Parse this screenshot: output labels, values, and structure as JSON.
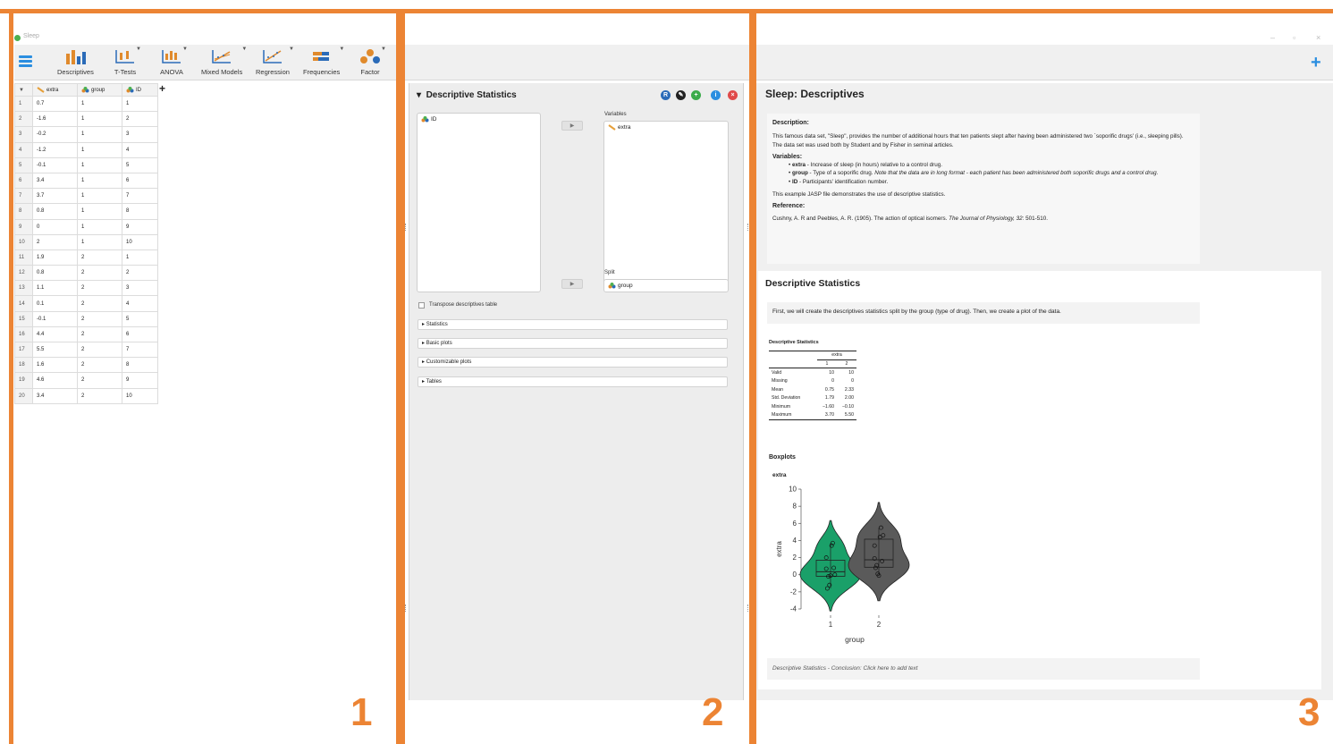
{
  "window": {
    "title": "Sleep"
  },
  "toolbar": {
    "items": [
      {
        "label": "Descriptives",
        "icon": "descriptives-icon"
      },
      {
        "label": "T-Tests",
        "icon": "t-tests-icon"
      },
      {
        "label": "ANOVA",
        "icon": "anova-icon"
      },
      {
        "label": "Mixed Models",
        "icon": "mixed-models-icon"
      },
      {
        "label": "Regression",
        "icon": "regression-icon"
      },
      {
        "label": "Frequencies",
        "icon": "frequencies-icon"
      },
      {
        "label": "Factor",
        "icon": "factor-icon"
      }
    ]
  },
  "grid": {
    "columns": [
      "extra",
      "group",
      "ID"
    ],
    "rows": [
      [
        "1",
        "0.7",
        "1",
        "1"
      ],
      [
        "2",
        "-1.6",
        "1",
        "2"
      ],
      [
        "3",
        "-0.2",
        "1",
        "3"
      ],
      [
        "4",
        "-1.2",
        "1",
        "4"
      ],
      [
        "5",
        "-0.1",
        "1",
        "5"
      ],
      [
        "6",
        "3.4",
        "1",
        "6"
      ],
      [
        "7",
        "3.7",
        "1",
        "7"
      ],
      [
        "8",
        "0.8",
        "1",
        "8"
      ],
      [
        "9",
        "0",
        "1",
        "9"
      ],
      [
        "10",
        "2",
        "1",
        "10"
      ],
      [
        "11",
        "1.9",
        "2",
        "1"
      ],
      [
        "12",
        "0.8",
        "2",
        "2"
      ],
      [
        "13",
        "1.1",
        "2",
        "3"
      ],
      [
        "14",
        "0.1",
        "2",
        "4"
      ],
      [
        "15",
        "-0.1",
        "2",
        "5"
      ],
      [
        "16",
        "4.4",
        "2",
        "6"
      ],
      [
        "17",
        "5.5",
        "2",
        "7"
      ],
      [
        "18",
        "1.6",
        "2",
        "8"
      ],
      [
        "19",
        "4.6",
        "2",
        "9"
      ],
      [
        "20",
        "3.4",
        "2",
        "10"
      ]
    ]
  },
  "analysis": {
    "title": "Descriptive Statistics",
    "available": [
      "ID"
    ],
    "variables_label": "Variables",
    "variables": [
      "extra"
    ],
    "split_label": "Split",
    "split": "group",
    "transpose_label": "Transpose descriptives table",
    "sections": [
      "Statistics",
      "Basic plots",
      "Customizable plots",
      "Tables"
    ],
    "header_buttons": [
      "R",
      "✎",
      "+",
      "i",
      "×"
    ]
  },
  "results": {
    "title": "Sleep: Descriptives",
    "description": {
      "heading": "Description:",
      "body": "This famous data set, \"Sleep\", provides the number of additional hours that ten patients slept after having been administered two `soporific drugs' (i.e., sleeping pills). The data set was used both by Student and by Fisher in seminal articles.",
      "variables_heading": "Variables:",
      "var_extra_name": "extra",
      "var_extra_desc": " - Increase of sleep (in hours) relative to a control drug.",
      "var_group_name": "group",
      "var_group_desc": " - Type of a soporific drug. ",
      "var_group_note": "Note that the data are in long format - each patient has been administered both soporific drugs and a control drug.",
      "var_id_name": "ID",
      "var_id_desc": " - Participants' identification number.",
      "demo": "This example JASP file demonstrates the use of descriptive statistics.",
      "reference_heading": "Reference:",
      "reference_text": "Cushny, A. R and Peebles, A. R. (1905). The action of optical isomers. ",
      "reference_journal": "The Journal of Physiology, 32",
      "reference_pages": ": 501-510."
    },
    "section_title": "Descriptive Statistics",
    "intro": "First, we will create the descriptives statistics split by the group (type of drug). Then, we create a plot of the data.",
    "table": {
      "caption": "Descriptive Statistics",
      "variable": "extra",
      "groups": [
        "1",
        "2"
      ],
      "rows": [
        [
          "Valid",
          "10",
          "10"
        ],
        [
          "Missing",
          "0",
          "0"
        ],
        [
          "Mean",
          "0.75",
          "2.33"
        ],
        [
          "Std. Deviation",
          "1.79",
          "2.00"
        ],
        [
          "Minimum",
          "−1.60",
          "−0.10"
        ],
        [
          "Maximum",
          "3.70",
          "5.50"
        ]
      ]
    },
    "boxplots_title": "Boxplots",
    "plot_title": "extra",
    "conclusion": "Descriptive Statistics - Conclusion: Click here to add text"
  },
  "chart_data": {
    "type": "violin-boxplot",
    "title": "extra",
    "xlabel": "group",
    "ylabel": "extra",
    "ylim": [
      -4,
      10
    ],
    "yticks": [
      -4,
      -2,
      0,
      2,
      4,
      6,
      8,
      10
    ],
    "categories": [
      "1",
      "2"
    ],
    "series": [
      {
        "name": "1",
        "color": "#1aa069",
        "values": [
          0.7,
          -1.6,
          -0.2,
          -1.2,
          -0.1,
          3.4,
          3.7,
          0.8,
          0.0,
          2.0
        ]
      },
      {
        "name": "2",
        "color": "#5a5a5a",
        "values": [
          1.9,
          0.8,
          1.1,
          0.1,
          -0.1,
          4.4,
          5.5,
          1.6,
          4.6,
          3.4
        ]
      }
    ]
  },
  "annotations": {
    "panel_1": "1",
    "panel_2": "2",
    "panel_3": "3",
    "color": "#ec8434"
  }
}
